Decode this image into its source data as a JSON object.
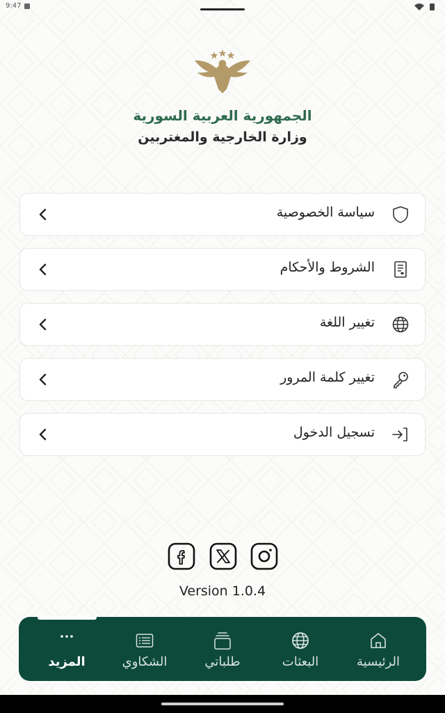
{
  "status_bar": {
    "time": "9:47"
  },
  "header": {
    "country": "الجمهورية العربية السورية",
    "ministry": "وزارة الخارجية والمغتربين"
  },
  "menu": {
    "items": [
      {
        "label": "سياسة الخصوصية",
        "icon": "shield-icon"
      },
      {
        "label": "الشروط والأحكام",
        "icon": "document-icon"
      },
      {
        "label": "تغيير اللغة",
        "icon": "globe-icon"
      },
      {
        "label": "تغيير كلمة المرور",
        "icon": "key-icon"
      },
      {
        "label": "تسجيل الدخول",
        "icon": "login-icon"
      }
    ]
  },
  "social": {
    "items": [
      "facebook-icon",
      "x-icon",
      "instagram-icon"
    ]
  },
  "version": "Version 1.0.4",
  "bottom_nav": {
    "items": [
      {
        "label": "المزيد",
        "icon": "more-icon",
        "active": true
      },
      {
        "label": "الشكاوي",
        "icon": "complaints-icon",
        "active": false
      },
      {
        "label": "طلباتي",
        "icon": "requests-icon",
        "active": false
      },
      {
        "label": "البعثات",
        "icon": "globe-icon",
        "active": false
      },
      {
        "label": "الرئيسية",
        "icon": "home-icon",
        "active": false
      }
    ]
  },
  "colors": {
    "primary": "#0d4a3b",
    "brand_green": "#2f6b4f",
    "emblem_gold": "#b39a68"
  }
}
